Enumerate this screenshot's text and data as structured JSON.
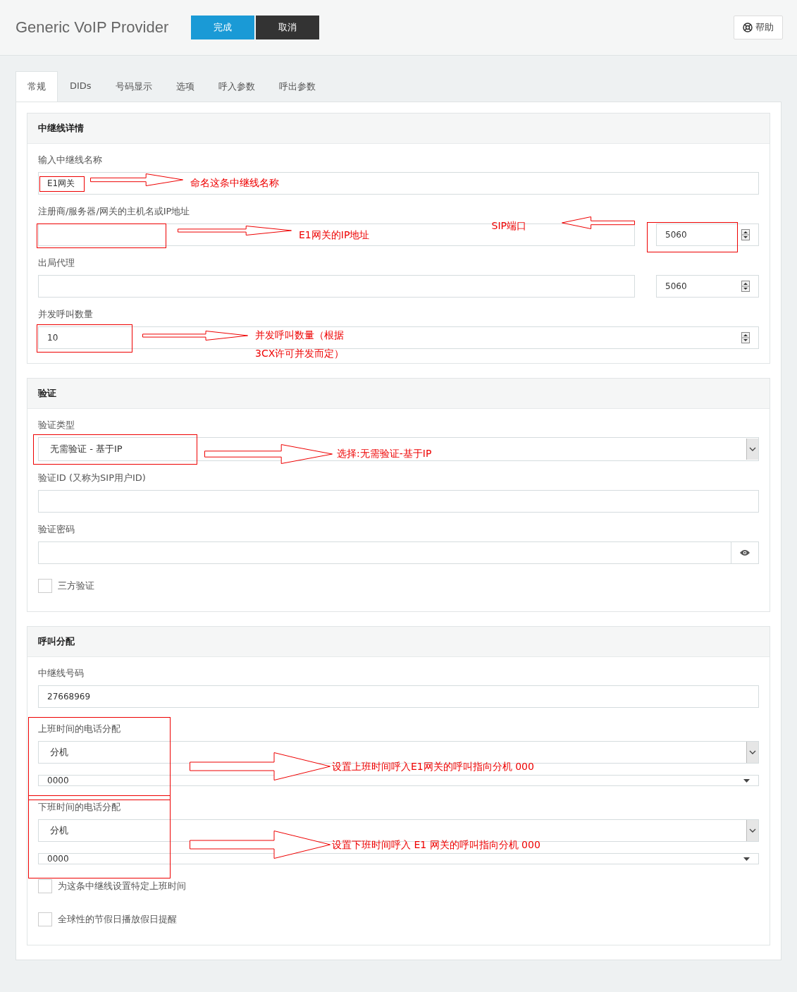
{
  "header": {
    "title": "Generic VoIP Provider",
    "buttons": [
      {
        "label": "完成",
        "kind": "primary"
      },
      {
        "label": "取消",
        "kind": "dark"
      }
    ],
    "help": "帮助"
  },
  "tabs": [
    {
      "label": "常规",
      "selected": true
    },
    {
      "label": "DIDs",
      "selected": false
    },
    {
      "label": "号码显示",
      "selected": false
    },
    {
      "label": "选项",
      "selected": false
    },
    {
      "label": "呼入参数",
      "selected": false
    },
    {
      "label": "呼出参数",
      "selected": false
    }
  ],
  "sections": [
    {
      "title": "中继线详情",
      "fields": [
        {
          "kind": "text",
          "label": "输入中继线名称",
          "value": "E1网关",
          "highlight": true,
          "note": "命名这条中继线名称"
        },
        {
          "kind": "host",
          "label": "注册商/服务器/网关的主机名或IP地址",
          "highlight": true,
          "note": "E1网关的IP地址",
          "port": "5060",
          "port_highlight": true,
          "port_note": "SIP端口"
        },
        {
          "kind": "host",
          "label": "出局代理",
          "port": "5060"
        },
        {
          "kind": "number",
          "label": "并发呼叫数量",
          "value": "10",
          "highlight": true,
          "note_lines": [
            "并发呼叫数量（根据",
            "3CX许可并发而定）"
          ]
        }
      ]
    },
    {
      "title": "验证",
      "fields": [
        {
          "kind": "select",
          "label": "验证类型",
          "value": "无需验证 - 基于IP",
          "highlight": true,
          "note": "选择:无需验证-基于IP"
        },
        {
          "kind": "text",
          "label": "验证ID (又称为SIP用户ID)"
        },
        {
          "kind": "password",
          "label": "验证密码"
        },
        {
          "kind": "checkbox",
          "label": "三方验证",
          "checked": false
        }
      ]
    },
    {
      "title": "呼叫分配",
      "fields": [
        {
          "kind": "text",
          "label": "中继线号码",
          "value": "27668969"
        },
        {
          "kind": "extension",
          "label": "上班时间的电话分配",
          "type": "分机",
          "value": "0000",
          "highlight": true,
          "note": "设置上班时间呼入E1网关的呼叫指向分机 000"
        },
        {
          "kind": "extension",
          "label": "下班时间的电话分配",
          "type": "分机",
          "value": "0000",
          "highlight": true,
          "note": "设置下班时间呼入 E1 网关的呼叫指向分机 000"
        },
        {
          "kind": "checkbox",
          "label": "为这条中继线设置特定上班时间",
          "checked": false
        },
        {
          "kind": "checkbox",
          "label": "全球性的节假日播放假日提醒",
          "checked": false
        }
      ]
    }
  ]
}
